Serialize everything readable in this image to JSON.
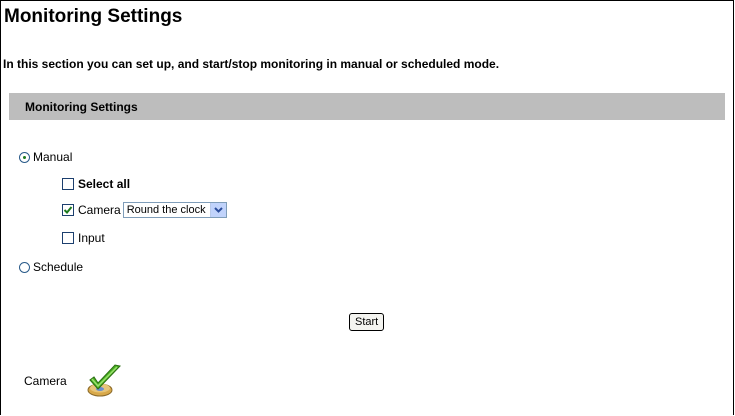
{
  "page": {
    "title": "Monitoring Settings",
    "intro": "In this section you can set up, and start/stop monitoring in manual or scheduled mode."
  },
  "section": {
    "header": "Monitoring Settings"
  },
  "mode": {
    "manual_label": "Manual",
    "manual_selected": true,
    "schedule_label": "Schedule",
    "schedule_selected": false
  },
  "options": {
    "select_all_label": "Select all",
    "select_all_checked": false,
    "camera_label": "Camera",
    "camera_checked": true,
    "camera_schedule_value": "Round the clock",
    "input_label": "Input",
    "input_checked": false
  },
  "actions": {
    "start_label": "Start"
  },
  "status": {
    "camera_label": "Camera",
    "camera_icon": "camera-ok-check-icon"
  },
  "colors": {
    "section_header_bg": "#bdbdbd",
    "check_green": "#1d7a1d"
  }
}
